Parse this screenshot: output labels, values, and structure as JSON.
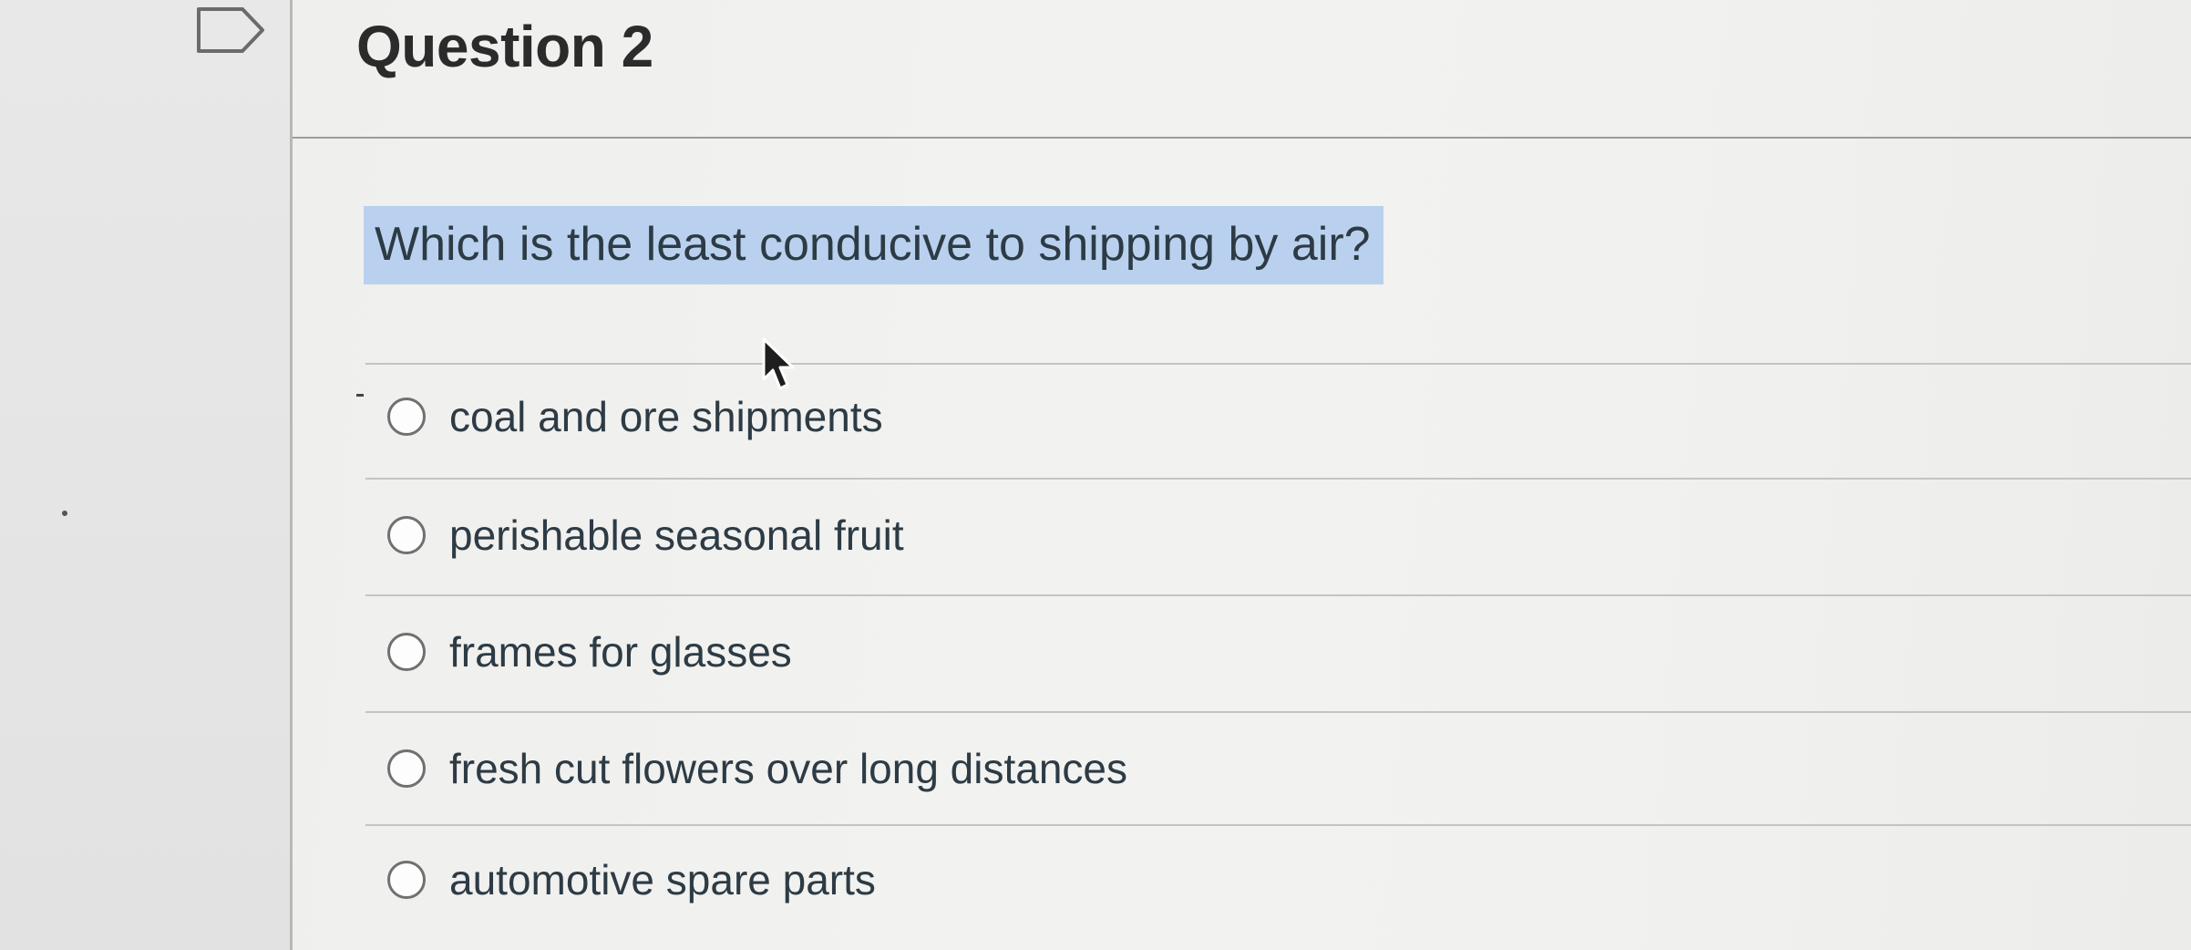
{
  "quiz": {
    "question_title": "Question 2",
    "question_text": "Which is the least conducive to shipping by air?",
    "answers": [
      {
        "label": "coal and ore shipments",
        "selected": false
      },
      {
        "label": "perishable seasonal fruit",
        "selected": false
      },
      {
        "label": "frames for glasses",
        "selected": false
      },
      {
        "label": "fresh cut flowers over long distances",
        "selected": false
      },
      {
        "label": "automotive spare parts",
        "selected": false
      }
    ]
  },
  "icons": {
    "flag": "flag-question-icon",
    "cursor": "mouse-cursor-icon",
    "radio": "radio-button-icon"
  },
  "colors": {
    "question_highlight": "#b9d1ee",
    "text": "#2d3b45"
  }
}
